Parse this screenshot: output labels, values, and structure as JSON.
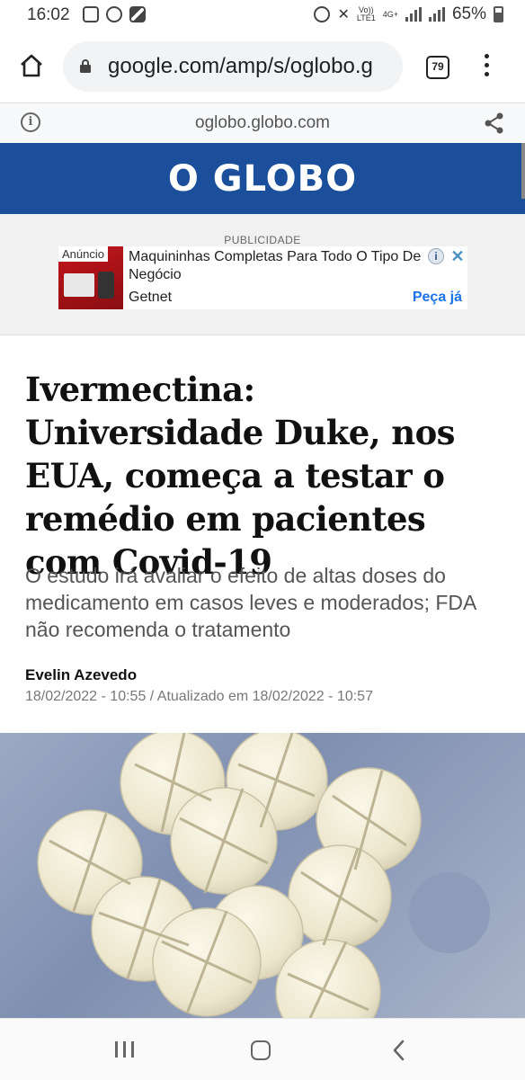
{
  "status_bar": {
    "time": "16:02",
    "carrier_top": "Vo))",
    "carrier_bottom": "LTE1",
    "network": "4G+",
    "battery": "65%"
  },
  "browser": {
    "url": "google.com/amp/s/oglobo.g",
    "tab_count": "79",
    "amp_domain": "oglobo.globo.com"
  },
  "site": {
    "logo": "O GLOBO"
  },
  "ad": {
    "label": "PUBLICIDADE",
    "tag": "Anúncio",
    "title": "Maquininhas Completas Para Todo O Tipo De Negócio",
    "advertiser": "Getnet",
    "cta": "Peça já"
  },
  "article": {
    "headline": "Ivermectina: Universidade Duke, nos EUA, começa a testar o remédio em pacientes com Covid-19",
    "subheadline": "O estudo irá avaliar o efeito de altas doses do medicamento em casos leves e moderados; FDA não recomenda o tratamento",
    "author": "Evelin Azevedo",
    "dates": "18/02/2022 - 10:55 / Atualizado em 18/02/2022 - 10:57"
  },
  "icons": {
    "home": "home-icon",
    "lock": "lock-icon",
    "tabs": "tabs-icon",
    "menu": "more-vert-icon",
    "info": "info-icon",
    "share": "share-icon"
  },
  "colors": {
    "brand_blue": "#1b4e9b",
    "ad_link": "#1a73e8"
  }
}
